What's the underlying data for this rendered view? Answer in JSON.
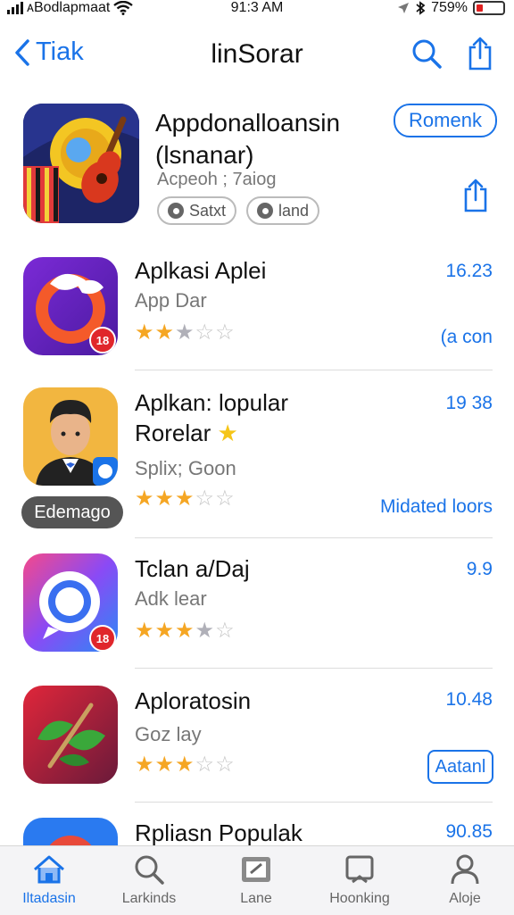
{
  "status_bar": {
    "carrier": "ᴀBodlapmaat",
    "time": "91:3 AM",
    "battery_percent": "759%",
    "battery_level": 0.25
  },
  "nav": {
    "back_label": "Tiak",
    "title": "linSorar"
  },
  "featured": {
    "title_line1": "Appdonalloansin",
    "title_line2": "(lsnanar)",
    "subtitle": "Acpeoh ; 7aiog",
    "chip1": "Satxt",
    "chip2": "land",
    "get_button": "Romenk"
  },
  "apps": [
    {
      "name": "Aplkasi Aplei",
      "subtitle": "App Dar",
      "rating": 2.5,
      "meta": "16.23",
      "action": "(a con",
      "action_style": "link",
      "badge": "18",
      "tag": ""
    },
    {
      "name": "Aplkan: lopular",
      "name_line2": "Rorelar",
      "subtitle": "Splix; Goon",
      "rating": 3,
      "meta": "19 38",
      "action": "Midated loors",
      "action_style": "link",
      "badge": "",
      "tag": "Edemago"
    },
    {
      "name": "Tclan a/Daj",
      "subtitle": "Adk lear",
      "rating": 3.5,
      "meta": "9.9",
      "action": "",
      "action_style": "none",
      "badge": "18",
      "tag": ""
    },
    {
      "name": "Aploratosin",
      "subtitle": "Goz lay",
      "rating": 3,
      "meta": "10.48",
      "action": "Aatanl",
      "action_style": "button",
      "badge": "",
      "tag": ""
    },
    {
      "name": "Rpliasn Populak",
      "subtitle": "",
      "rating": 0,
      "meta": "90.85",
      "action": "",
      "action_style": "none",
      "badge": "",
      "tag": ""
    }
  ],
  "tabs": [
    {
      "label": "Iltadasin",
      "icon": "home-icon",
      "active": true
    },
    {
      "label": "Larkinds",
      "icon": "search-icon",
      "active": false
    },
    {
      "label": "Lane",
      "icon": "library-icon",
      "active": false
    },
    {
      "label": "Hoonking",
      "icon": "inbox-icon",
      "active": false
    },
    {
      "label": "Aloje",
      "icon": "profile-icon",
      "active": false
    }
  ],
  "colors": {
    "accent": "#1a73e8",
    "star": "#f5a623",
    "badge": "#e0262b"
  }
}
